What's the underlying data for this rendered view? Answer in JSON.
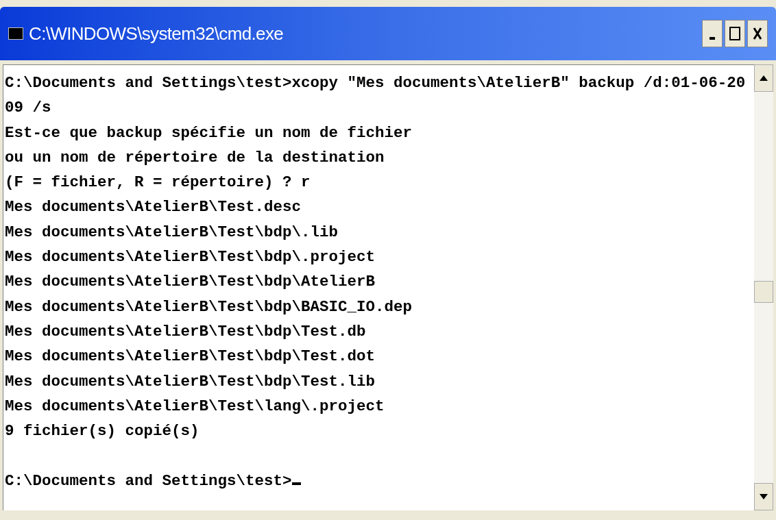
{
  "window": {
    "title": "C:\\WINDOWS\\system32\\cmd.exe"
  },
  "console": {
    "lines": [
      "C:\\Documents and Settings\\test>xcopy \"Mes documents\\AtelierB\" backup /d:01-06-20",
      "09 /s",
      "Est-ce que backup spécifie un nom de fichier",
      "ou un nom de répertoire de la destination",
      "(F = fichier, R = répertoire) ? r",
      "Mes documents\\AtelierB\\Test.desc",
      "Mes documents\\AtelierB\\Test\\bdp\\.lib",
      "Mes documents\\AtelierB\\Test\\bdp\\.project",
      "Mes documents\\AtelierB\\Test\\bdp\\AtelierB",
      "Mes documents\\AtelierB\\Test\\bdp\\BASIC_IO.dep",
      "Mes documents\\AtelierB\\Test\\bdp\\Test.db",
      "Mes documents\\AtelierB\\Test\\bdp\\Test.dot",
      "Mes documents\\AtelierB\\Test\\bdp\\Test.lib",
      "Mes documents\\AtelierB\\Test\\lang\\.project",
      "9 fichier(s) copié(s)"
    ],
    "prompt": {
      "text": "C:\\Documents and Settings\\test>",
      "cursor": true
    }
  }
}
